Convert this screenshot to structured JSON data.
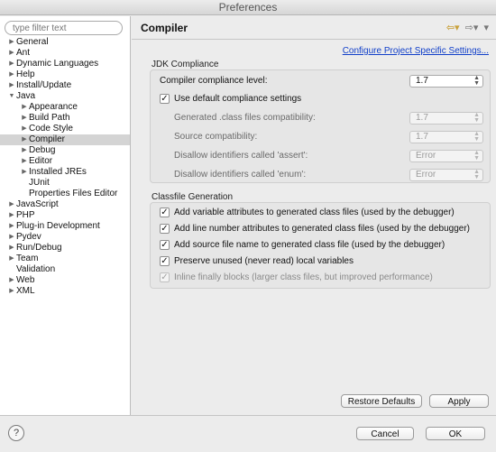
{
  "window": {
    "title": "Preferences"
  },
  "filter": {
    "placeholder": "type filter text"
  },
  "tree": [
    {
      "label": "General",
      "level": 0,
      "arrow": "right"
    },
    {
      "label": "Ant",
      "level": 0,
      "arrow": "right"
    },
    {
      "label": "Dynamic Languages",
      "level": 0,
      "arrow": "right"
    },
    {
      "label": "Help",
      "level": 0,
      "arrow": "right"
    },
    {
      "label": "Install/Update",
      "level": 0,
      "arrow": "right"
    },
    {
      "label": "Java",
      "level": 0,
      "arrow": "down"
    },
    {
      "label": "Appearance",
      "level": 1,
      "arrow": "right"
    },
    {
      "label": "Build Path",
      "level": 1,
      "arrow": "right"
    },
    {
      "label": "Code Style",
      "level": 1,
      "arrow": "right"
    },
    {
      "label": "Compiler",
      "level": 1,
      "arrow": "right",
      "selected": true
    },
    {
      "label": "Debug",
      "level": 1,
      "arrow": "right"
    },
    {
      "label": "Editor",
      "level": 1,
      "arrow": "right"
    },
    {
      "label": "Installed JREs",
      "level": 1,
      "arrow": "right"
    },
    {
      "label": "JUnit",
      "level": 1,
      "arrow": "none"
    },
    {
      "label": "Properties Files Editor",
      "level": 1,
      "arrow": "none"
    },
    {
      "label": "JavaScript",
      "level": 0,
      "arrow": "right"
    },
    {
      "label": "PHP",
      "level": 0,
      "arrow": "right"
    },
    {
      "label": "Plug-in Development",
      "level": 0,
      "arrow": "right"
    },
    {
      "label": "Pydev",
      "level": 0,
      "arrow": "right"
    },
    {
      "label": "Run/Debug",
      "level": 0,
      "arrow": "right"
    },
    {
      "label": "Team",
      "level": 0,
      "arrow": "right"
    },
    {
      "label": "Validation",
      "level": 0,
      "arrow": "none"
    },
    {
      "label": "Web",
      "level": 0,
      "arrow": "right"
    },
    {
      "label": "XML",
      "level": 0,
      "arrow": "right"
    }
  ],
  "page": {
    "title": "Compiler",
    "config_link": "Configure Project Specific Settings...",
    "nav": {
      "back_icon": "back-arrow-icon",
      "forward_icon": "forward-arrow-icon",
      "menu_icon": "view-menu-icon"
    }
  },
  "jdk": {
    "group_label": "JDK Compliance",
    "compliance_level_label": "Compiler compliance level:",
    "compliance_level_value": "1.7",
    "use_default_label": "Use default compliance settings",
    "use_default_checked": true,
    "generated_label": "Generated .class files compatibility:",
    "generated_value": "1.7",
    "source_label": "Source compatibility:",
    "source_value": "1.7",
    "assert_label": "Disallow identifiers called 'assert':",
    "assert_value": "Error",
    "enum_label": "Disallow identifiers called 'enum':",
    "enum_value": "Error"
  },
  "classfile": {
    "group_label": "Classfile Generation",
    "options": [
      {
        "label": "Add variable attributes to generated class files (used by the debugger)",
        "checked": true,
        "disabled": false
      },
      {
        "label": "Add line number attributes to generated class files (used by the debugger)",
        "checked": true,
        "disabled": false
      },
      {
        "label": "Add source file name to generated class file (used by the debugger)",
        "checked": true,
        "disabled": false
      },
      {
        "label": "Preserve unused (never read) local variables",
        "checked": true,
        "disabled": false
      },
      {
        "label": "Inline finally blocks (larger class files, but improved performance)",
        "checked": true,
        "disabled": true
      }
    ]
  },
  "buttons": {
    "restore_defaults": "Restore Defaults",
    "apply": "Apply",
    "cancel": "Cancel",
    "ok": "OK",
    "help_glyph": "?"
  }
}
